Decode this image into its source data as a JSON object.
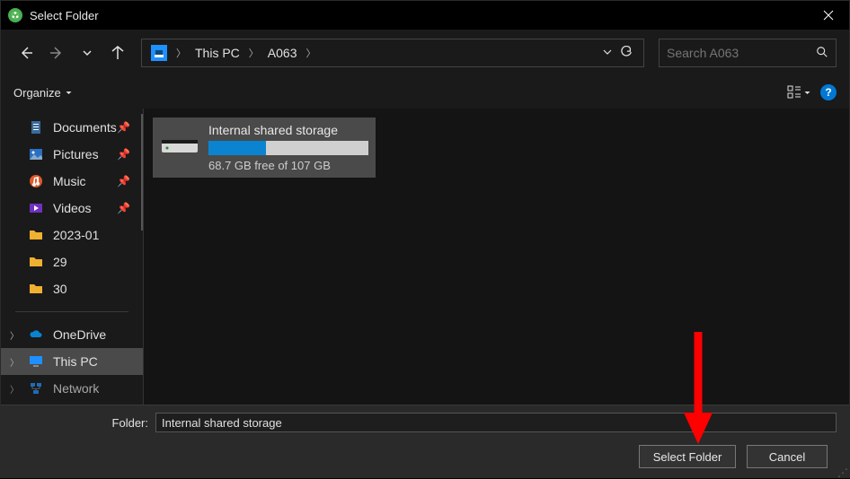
{
  "window": {
    "title": "Select Folder"
  },
  "breadcrumb": {
    "items": [
      "This PC",
      "A063"
    ]
  },
  "search": {
    "placeholder": "Search A063"
  },
  "toolbar": {
    "organize": "Organize"
  },
  "sidebar": {
    "items": [
      {
        "label": "Documents",
        "icon": "doc",
        "pinned": true
      },
      {
        "label": "Pictures",
        "icon": "pic",
        "pinned": true
      },
      {
        "label": "Music",
        "icon": "music",
        "pinned": true
      },
      {
        "label": "Videos",
        "icon": "video",
        "pinned": true
      },
      {
        "label": "2023-01",
        "icon": "folder",
        "pinned": false
      },
      {
        "label": "29",
        "icon": "folder",
        "pinned": false
      },
      {
        "label": "30",
        "icon": "folder",
        "pinned": false
      }
    ],
    "roots": [
      {
        "label": "OneDrive",
        "icon": "cloud"
      },
      {
        "label": "This PC",
        "icon": "pc",
        "selected": true
      },
      {
        "label": "Network",
        "icon": "net"
      }
    ]
  },
  "content": {
    "drive": {
      "name": "Internal shared storage",
      "free_text": "68.7 GB free of 107 GB",
      "used_percent": 36
    }
  },
  "footer": {
    "folder_label": "Folder:",
    "folder_value": "Internal shared storage",
    "select_label": "Select Folder",
    "cancel_label": "Cancel"
  }
}
